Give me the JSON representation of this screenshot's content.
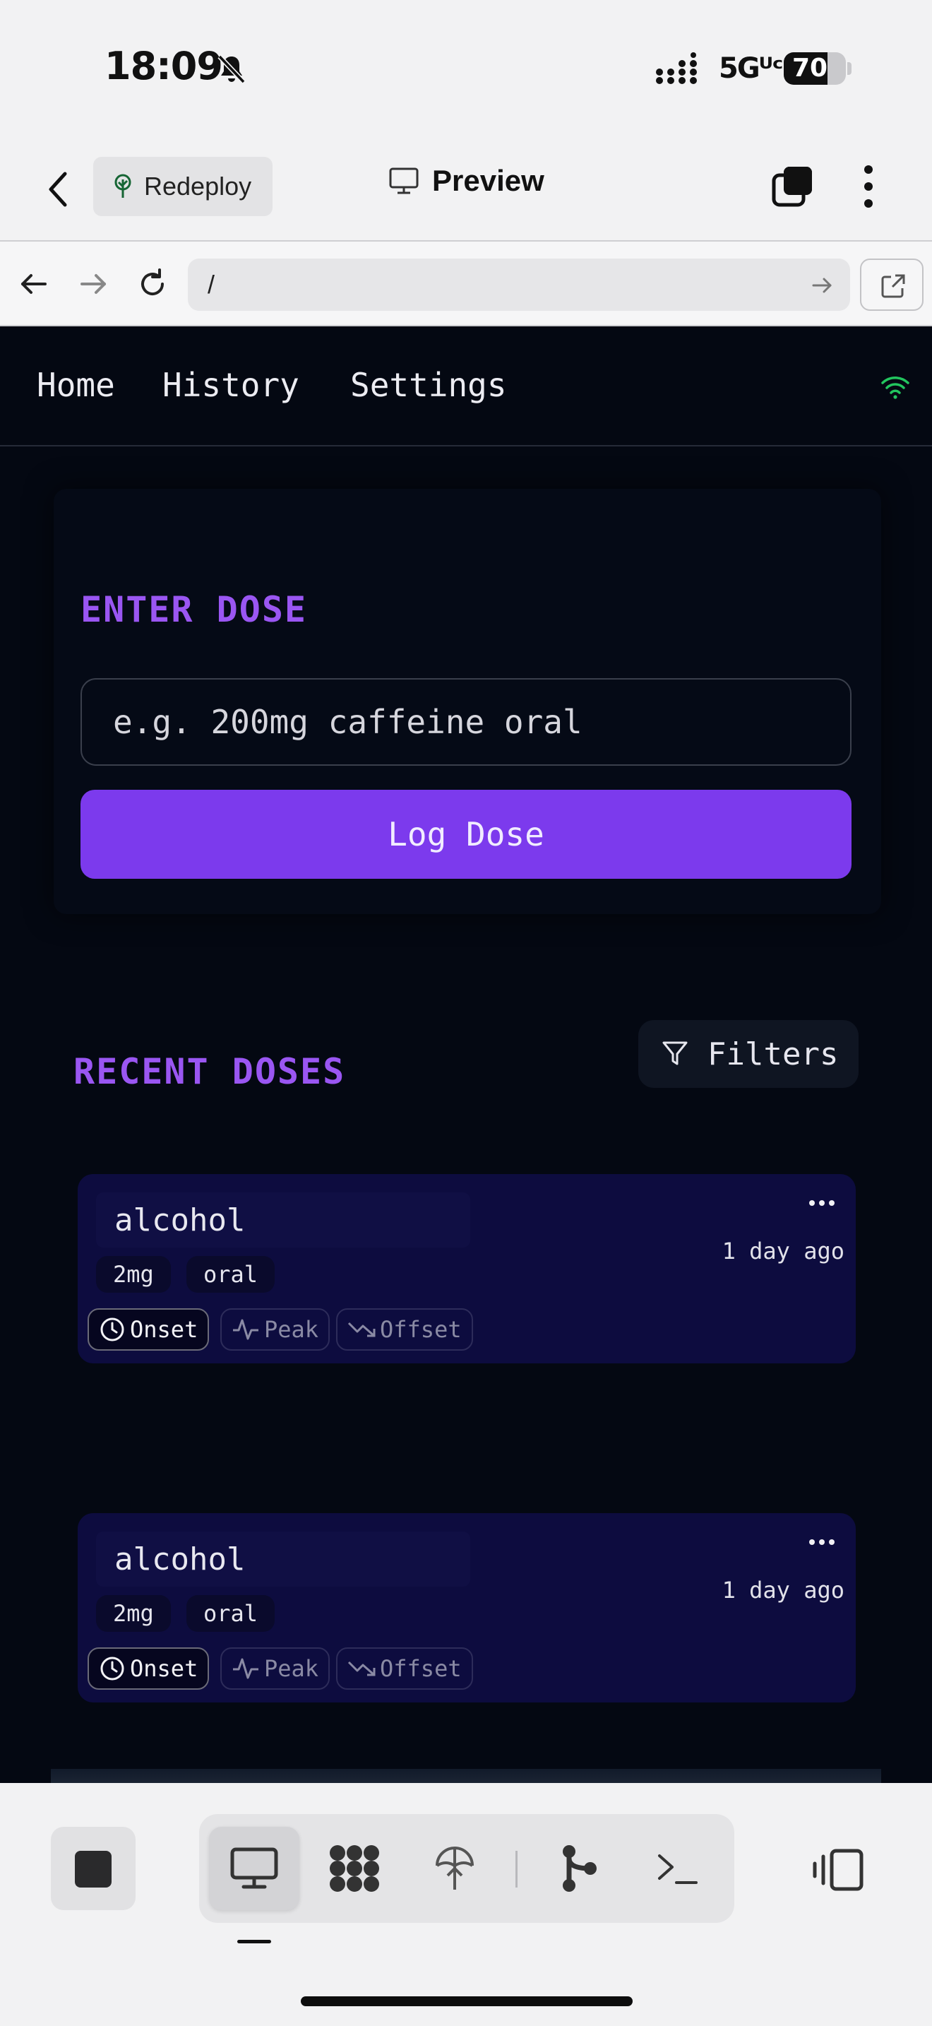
{
  "status_bar": {
    "time": "18:09",
    "network": "5Gᵁᶜ",
    "battery": "70",
    "battery_level": 0.7
  },
  "header": {
    "redeploy_label": "Redeploy",
    "preview_label": "Preview"
  },
  "url_bar": {
    "url": "/"
  },
  "web": {
    "nav": {
      "items": [
        "Home",
        "History",
        "Settings"
      ],
      "connection_color": "#22c55e"
    },
    "enter_dose": {
      "title": "ENTER DOSE",
      "input_placeholder": "e.g. 200mg caffeine oral",
      "input_value": "",
      "submit_label": "Log Dose"
    },
    "recent": {
      "title": "RECENT DOSES",
      "filters_label": "Filters",
      "doses": [
        {
          "substance": "alcohol",
          "amount": "2mg",
          "route": "oral",
          "time_ago": "1 day ago",
          "phases": [
            "Onset",
            "Peak",
            "Offset"
          ],
          "active_phase": "Onset"
        },
        {
          "substance": "alcohol",
          "amount": "2mg",
          "route": "oral",
          "time_ago": "1 day ago",
          "phases": [
            "Onset",
            "Peak",
            "Offset"
          ],
          "active_phase": "Onset"
        }
      ]
    },
    "accent_color": "#7c3aed"
  },
  "toolbar": {
    "icons": [
      "stop-icon",
      "desktop-preview-icon",
      "grid-apps-icon",
      "deploy-icon",
      "branch-icon",
      "terminal-icon",
      "panel-toggle-icon"
    ]
  }
}
